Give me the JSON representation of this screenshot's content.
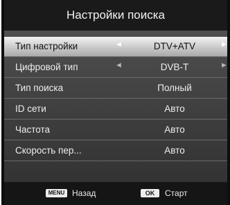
{
  "header": {
    "title": "Настройки поиска"
  },
  "rows": [
    {
      "label": "Тип настройки",
      "value": "DTV+ATV",
      "left_arrow": "◄",
      "right_arrow": "►"
    },
    {
      "label": "Цифровой тип",
      "value": "DVB-T",
      "left_arrow": "◄",
      "right_arrow": "►"
    },
    {
      "label": "Тип поиска",
      "value": "Полный"
    },
    {
      "label": "ID сети",
      "value": "Авто"
    },
    {
      "label": "Частота",
      "value": "Авто"
    },
    {
      "label": "Скорость пер...",
      "value": "Авто"
    }
  ],
  "footer": {
    "menu_key": "MENU",
    "back_label": "Назад",
    "ok_key": "OK",
    "start_label": "Старт"
  },
  "colors": {
    "selected_highlight": "#d9d9d9",
    "list_background": "#444444",
    "title_background": "#1a1a1a"
  }
}
